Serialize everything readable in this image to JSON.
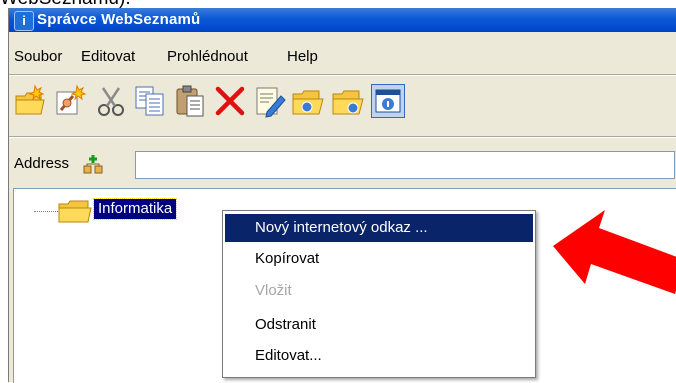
{
  "caption": "WebSeznamů).",
  "window": {
    "title": "Správce WebSeznamů"
  },
  "menubar": {
    "items": [
      "Soubor",
      "Editovat",
      "Prohlédnout",
      "Help"
    ]
  },
  "toolbar": {
    "buttons": [
      "new-folder-icon",
      "new-link-icon",
      "cut-icon",
      "copy-icon",
      "paste-icon",
      "delete-icon",
      "edit-icon",
      "open-folder-icon",
      "export-folder-icon",
      "about-icon"
    ]
  },
  "addressbar": {
    "label": "Address",
    "value": ""
  },
  "tree": {
    "items": [
      {
        "label": "Informatika",
        "selected": true
      }
    ]
  },
  "context_menu": {
    "items": [
      {
        "label": "Nový internetový odkaz ...",
        "state": "selected"
      },
      {
        "label": "Kopírovat",
        "state": "normal"
      },
      {
        "label": "Vložit",
        "state": "disabled"
      },
      {
        "label": "Odstranit",
        "state": "normal"
      },
      {
        "label": "Editovat...",
        "state": "normal"
      }
    ]
  },
  "colors": {
    "titlebar": "#0a58d6",
    "selection": "#0a246a",
    "arrow": "#ff0000"
  }
}
